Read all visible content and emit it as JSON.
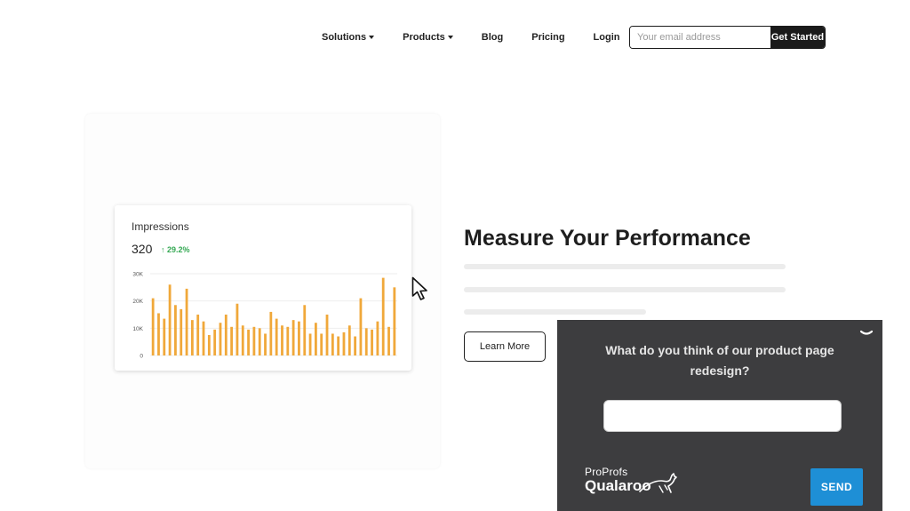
{
  "nav": {
    "items": [
      {
        "label": "Solutions",
        "dropdown": true
      },
      {
        "label": "Products",
        "dropdown": true
      },
      {
        "label": "Blog",
        "dropdown": false
      },
      {
        "label": "Pricing",
        "dropdown": false
      },
      {
        "label": "Login",
        "dropdown": false
      }
    ],
    "email_placeholder": "Your email address",
    "cta_label": "Get Started"
  },
  "impressions": {
    "title": "Impressions",
    "value": "320",
    "change": "↑ 29.2%",
    "colors": {
      "bar": "#f0a83a",
      "grid": "#eeeeee",
      "change": "#34a853"
    },
    "chart_data": {
      "type": "bar",
      "yticks": [
        "0",
        "10K",
        "20K",
        "30K"
      ],
      "ylim": [
        0,
        30000
      ],
      "values": [
        21000,
        15500,
        13500,
        26000,
        18500,
        17000,
        24500,
        13000,
        15000,
        12500,
        7500,
        9500,
        12000,
        15000,
        10500,
        19000,
        11000,
        9500,
        10500,
        10000,
        8000,
        16000,
        13500,
        11000,
        10500,
        13000,
        12500,
        18500,
        8000,
        12000,
        8000,
        15000,
        8000,
        7000,
        8500,
        11000,
        7000,
        21000,
        10000,
        9500,
        12500,
        28500,
        10500,
        25000
      ]
    }
  },
  "hero": {
    "headline": "Measure Your Performance",
    "learn_more_label": "Learn More"
  },
  "survey": {
    "question": "What do you think of our product page redesign?",
    "brand_top": "ProProfs",
    "brand_bottom": "Qualaroo",
    "send_label": "SEND",
    "colors": {
      "panel": "#3d3d3f",
      "send": "#1e8fd6"
    }
  }
}
